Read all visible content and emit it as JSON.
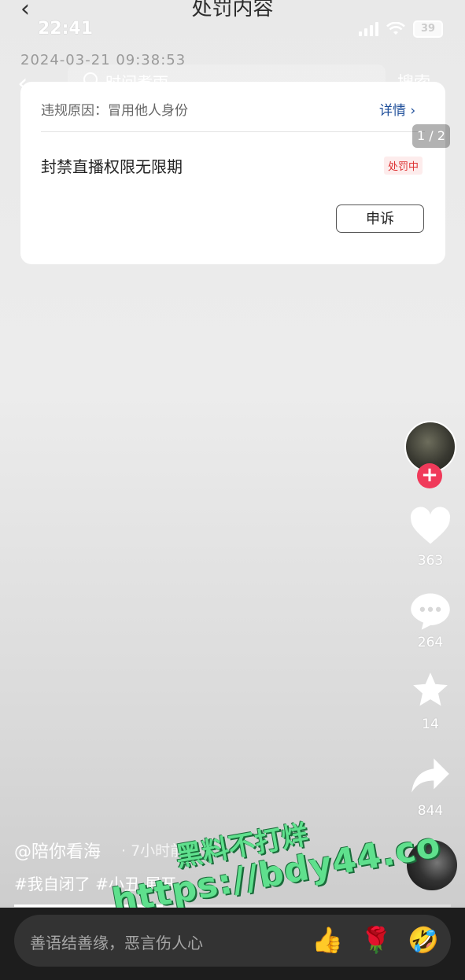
{
  "background_page": {
    "title": "处罚内容",
    "date": "2024-03-21 09:38:53"
  },
  "status_bar": {
    "time": "22:41",
    "battery": "39"
  },
  "search": {
    "placeholder": "时间煮雨",
    "button": "搜索"
  },
  "card": {
    "reason": "违规原因：冒用他人身份",
    "detail_link": "详情 ›",
    "pager": "1 / 2",
    "penalty": "封禁直播权限无限期",
    "status": "处罚中",
    "appeal_button": "申诉"
  },
  "rail": {
    "likes": "363",
    "comments": "264",
    "favorites": "14",
    "shares": "844"
  },
  "video": {
    "author": "@陪你看海",
    "time_ago": "· 7小时前",
    "caption": "#我自闭了 #小丑 展开",
    "progress": 0.34
  },
  "watermark": {
    "line1": "黑料不打烊",
    "line2": "https://bdy44.co"
  },
  "comment_input": {
    "placeholder": "善语结善缘，恶言伤人心"
  },
  "quick_emojis": [
    "👍",
    "🌹",
    "🤣"
  ],
  "icons": {
    "back": "chevron-left-icon",
    "search": "search-icon",
    "like": "heart-icon",
    "comment": "comment-bubble-icon",
    "favorite": "star-icon",
    "share": "share-arrow-icon"
  }
}
